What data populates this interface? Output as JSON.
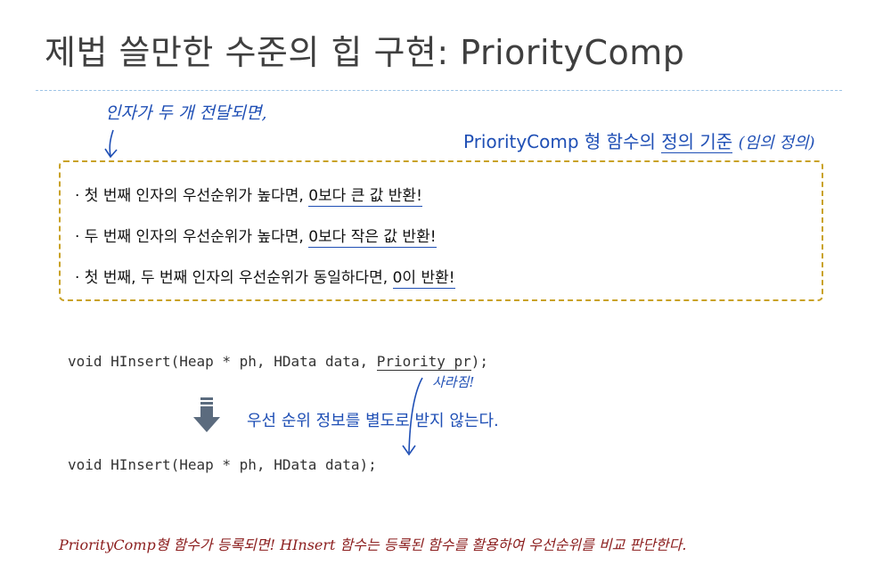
{
  "title": "제법 쓸만한 수준의 힙 구현: PriorityComp",
  "annotations": {
    "top_note": "인자가 두 개 전달되면,",
    "correction_note": "사라짐!"
  },
  "criteria": {
    "prefix": "PriorityComp 형 함수의 ",
    "underlined": "정의 기준",
    "note": "(임의 정의)"
  },
  "rules": [
    {
      "prefix": "· 첫 번째 인자의 우선순위가 높다면, ",
      "result": "0보다 큰 값 반환!"
    },
    {
      "prefix": "· 두 번째 인자의 우선순위가 높다면, ",
      "result": "0보다 작은 값 반환!"
    },
    {
      "prefix": "· 첫 번째, 두 번째 인자의 우선순위가 동일하다면, ",
      "result": "0이 반환!"
    }
  ],
  "code": {
    "before_prefix": "void HInsert(Heap * ph, HData data, ",
    "before_underlined": "Priority pr",
    "before_suffix": ");",
    "after": "void HInsert(Heap * ph, HData data);"
  },
  "arrow_text": "우선 순위 정보를 별도로 받지 않는다.",
  "bottom_note": "PriorityComp형 함수가 등록되면! HInsert 함수는 등록된 함수를 활용하여 우선순위를 비교 판단한다.",
  "colors": {
    "accent_blue": "#1f4fb5",
    "box_border": "#c9a227",
    "bottom_note": "#8b1d1d",
    "arrow": "#5b6b7e"
  }
}
